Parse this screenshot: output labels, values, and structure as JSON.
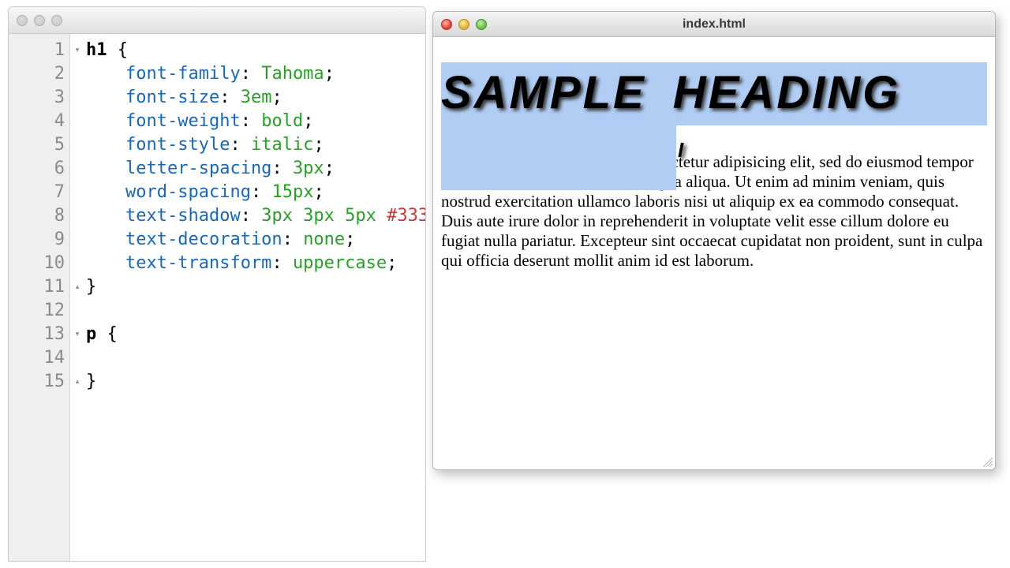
{
  "editor": {
    "gutter_lines": [
      "1",
      "2",
      "3",
      "4",
      "5",
      "6",
      "7",
      "8",
      "9",
      "10",
      "11",
      "12",
      "13",
      "14",
      "15"
    ],
    "fold_markers": {
      "1": "down",
      "11": "up",
      "13": "down",
      "15": "up"
    },
    "code_lines": [
      {
        "t": "rule_open",
        "sel": "h1",
        "brace": "{"
      },
      {
        "t": "decl",
        "prop": "font-family",
        "val": "Tahoma",
        "semi": ";"
      },
      {
        "t": "decl",
        "prop": "font-size",
        "val": "3em",
        "semi": ";"
      },
      {
        "t": "decl",
        "prop": "font-weight",
        "val": "bold",
        "semi": ";"
      },
      {
        "t": "decl",
        "prop": "font-style",
        "val": "italic",
        "semi": ";"
      },
      {
        "t": "decl",
        "prop": "letter-spacing",
        "val": "3px",
        "semi": ";"
      },
      {
        "t": "decl",
        "prop": "word-spacing",
        "val": "15px",
        "semi": ";"
      },
      {
        "t": "decl_shadow",
        "prop": "text-shadow",
        "val": "3px 3px 5px ",
        "hex": "#333",
        "semi": ";"
      },
      {
        "t": "decl",
        "prop": "text-decoration",
        "val": "none",
        "semi": ";"
      },
      {
        "t": "decl",
        "prop": "text-transform",
        "val": "uppercase",
        "semi": ";"
      },
      {
        "t": "rule_close",
        "brace": "}"
      },
      {
        "t": "blank"
      },
      {
        "t": "rule_open",
        "sel": "p",
        "brace": "{"
      },
      {
        "t": "blank"
      },
      {
        "t": "rule_close",
        "brace": "}"
      }
    ]
  },
  "preview": {
    "title": "index.html",
    "heading_text": "SAMPLE HEADING",
    "paragraph_text": "Lorem ipsum dolor sit amet, consectetur adipisicing elit, sed do eiusmod tempor incididunt ut labore et dolore magna aliqua. Ut enim ad minim veniam, quis nostrud exercitation ullamco laboris nisi ut aliquip ex ea commodo consequat. Duis aute irure dolor in reprehenderit in voluptate velit esse cillum dolore eu fugiat nulla pariatur. Excepteur sint occaecat cupidatat non proident, sunt in culpa qui officia deserunt mollit anim id est laborum.",
    "cursor_glyph": "I"
  }
}
